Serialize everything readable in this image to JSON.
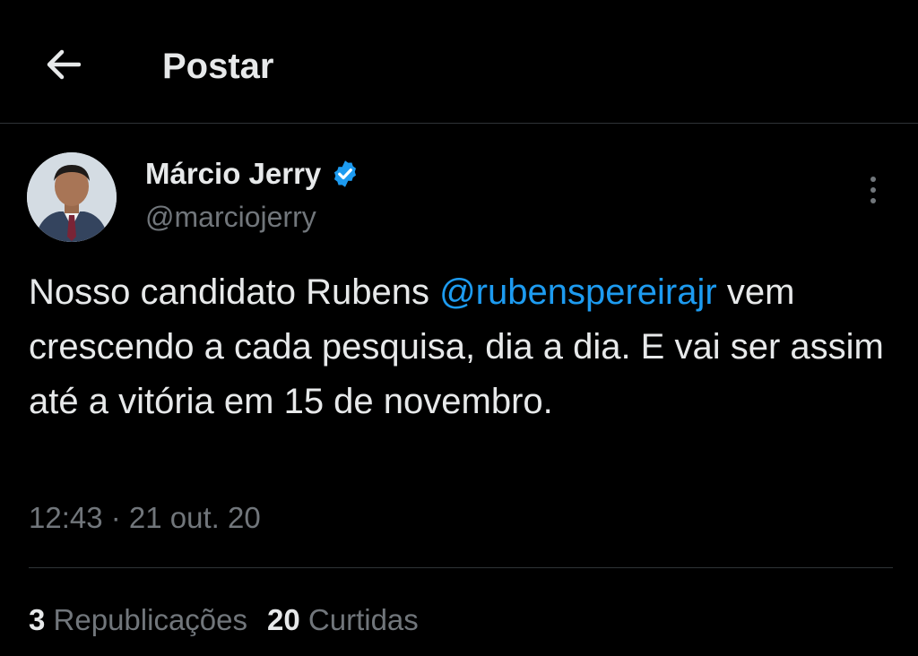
{
  "header": {
    "back_icon": "arrow-left-icon",
    "title": "Postar"
  },
  "post": {
    "author": {
      "name": "Márcio Jerry",
      "handle": "@marciojerry",
      "verified_icon": "verified-badge-icon",
      "verified_color": "#1d9bf0"
    },
    "more_icon": "more-vertical-icon",
    "text_before": "Nosso candidato Rubens ",
    "mention": "@rubenspereirajr",
    "text_after": " vem crescendo a cada pesquisa, dia a dia. E vai ser assim até a vitória em 15 de novembro.",
    "timestamp": "12:43 · 21 out. 20"
  },
  "stats": {
    "reposts_count": "3",
    "reposts_label": "Republicações",
    "likes_count": "20",
    "likes_label": "Curtidas"
  },
  "colors": {
    "background": "#000000",
    "text": "#e7e9ea",
    "secondary": "#71767b",
    "link": "#1d9bf0",
    "divider": "#2f3336"
  }
}
